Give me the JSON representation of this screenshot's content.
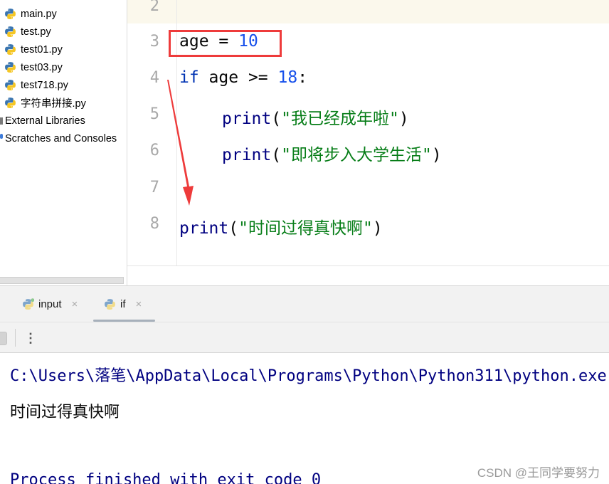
{
  "sidebar": {
    "items": [
      {
        "label": "main.py",
        "type": "python-file"
      },
      {
        "label": "test.py",
        "type": "python-file"
      },
      {
        "label": "test01.py",
        "type": "python-file"
      },
      {
        "label": "test03.py",
        "type": "python-file"
      },
      {
        "label": "test718.py",
        "type": "python-file"
      },
      {
        "label": "字符串拼接.py",
        "type": "python-file"
      },
      {
        "label": "External Libraries",
        "type": "libraries"
      },
      {
        "label": "Scratches and Consoles",
        "type": "scratches"
      }
    ]
  },
  "editor": {
    "line_numbers": [
      "2",
      "3",
      "4",
      "5",
      "6",
      "7",
      "8"
    ],
    "lines": {
      "l3": {
        "var": "age",
        "op": " = ",
        "num": "10"
      },
      "l4": {
        "kw": "if",
        "rest": " age >= ",
        "num": "18",
        "colon": ":"
      },
      "l5": {
        "fn": "print",
        "open": "(",
        "str": "\"我已经成年啦\"",
        "close": ")"
      },
      "l6": {
        "fn": "print",
        "open": "(",
        "str": "\"即将步入大学生活\"",
        "close": ")"
      },
      "l8": {
        "fn": "print",
        "open": "(",
        "str": "\"时间过得真快啊\"",
        "close": ")"
      }
    },
    "annotation_color": "#ee3b3b"
  },
  "run_panel": {
    "tabs": [
      {
        "label": "input",
        "close": "×",
        "active": false
      },
      {
        "label": "if",
        "close": "×",
        "active": true
      }
    ],
    "more_label": "⋮"
  },
  "console": {
    "command": "C:\\Users\\落笔\\AppData\\Local\\Programs\\Python\\Python311\\python.exe",
    "output": "时间过得真快啊",
    "exit_message": "Process finished with exit code 0"
  },
  "watermark": "CSDN @王同学要努力"
}
